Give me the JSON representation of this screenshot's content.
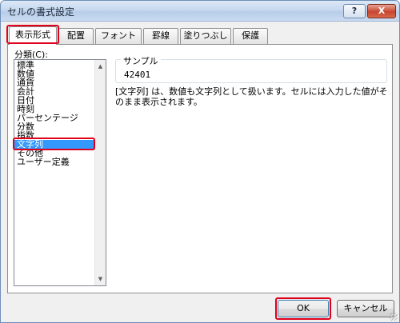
{
  "window": {
    "title": "セルの書式設定",
    "help_label": "?",
    "close_label": "X"
  },
  "tabs": [
    {
      "label": "表示形式",
      "active": true
    },
    {
      "label": "配置"
    },
    {
      "label": "フォント"
    },
    {
      "label": "罫線"
    },
    {
      "label": "塗りつぶし"
    },
    {
      "label": "保護"
    }
  ],
  "category": {
    "label": "分類(C):",
    "items": [
      "標準",
      "数値",
      "通貨",
      "会計",
      "日付",
      "時刻",
      "パーセンテージ",
      "分数",
      "指数",
      "文字列",
      "その他",
      "ユーザー定義"
    ],
    "selected": "文字列"
  },
  "sample": {
    "legend": "サンプル",
    "value": "42401"
  },
  "description": "[文字列] は、数値も文字列として扱います。セルには入力した値がそのまま表示されます。",
  "buttons": {
    "ok": "OK",
    "cancel": "キャンセル"
  },
  "colors": {
    "highlight": "#e0001b",
    "selection": "#3399ff"
  }
}
